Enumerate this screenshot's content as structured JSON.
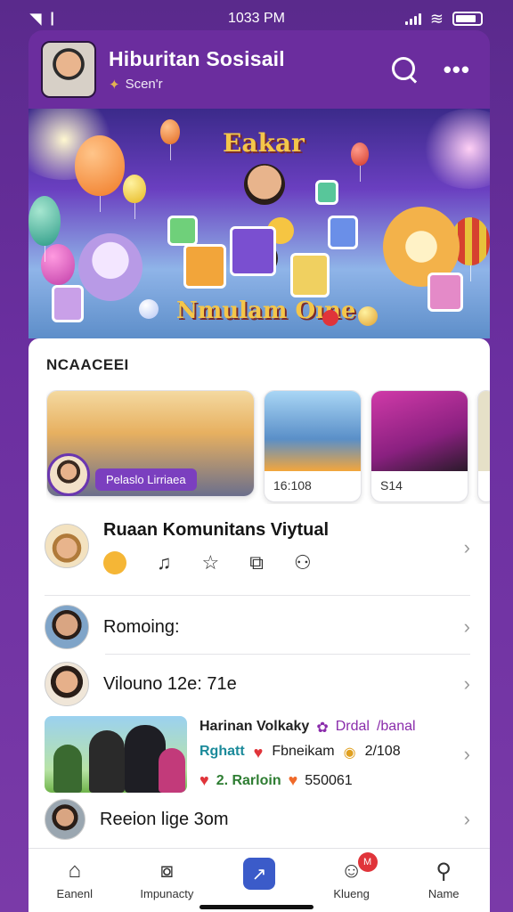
{
  "status_bar": {
    "time": "1033 PM"
  },
  "header": {
    "title": "Hiburitan Sosisail",
    "subtitle": "Scen'r"
  },
  "banner": {
    "title_top": "Eakar",
    "title_bottom": "Nmulam Oıne"
  },
  "section": {
    "label": "NCAACEEI"
  },
  "carousel": [
    {
      "badge": "Pelaslo Lirriaea"
    },
    {
      "meta": "16:108"
    },
    {
      "meta": "S14"
    }
  ],
  "community": {
    "title": "Ruaan Komunitans Viytual"
  },
  "rows": [
    {
      "title": "Romoing:"
    },
    {
      "title": "Vilouno 12e: 71e"
    }
  ],
  "promo": {
    "line1_a": "Harinan Volkaky",
    "line1_b": "Drdal",
    "line1_c": "/banal",
    "line2_a": "Rghatt",
    "line2_b": "Fbneikam",
    "line2_c": "2/108",
    "line3_a": "2. Rarloin",
    "line3_b": "550061"
  },
  "last_row": {
    "title": "Reeion lige 3om"
  },
  "nav": [
    {
      "label": "Eanenl"
    },
    {
      "label": "Impunacty"
    },
    {
      "label": ""
    },
    {
      "label": "Klueng",
      "badge": "M"
    },
    {
      "label": "Name"
    }
  ],
  "colors": {
    "background": "#6b2fa0",
    "header": "#6b2d9e",
    "accent_purple": "#7b3fbf",
    "nav_center": "#3b5bc9",
    "badge_red": "#e0343a"
  }
}
